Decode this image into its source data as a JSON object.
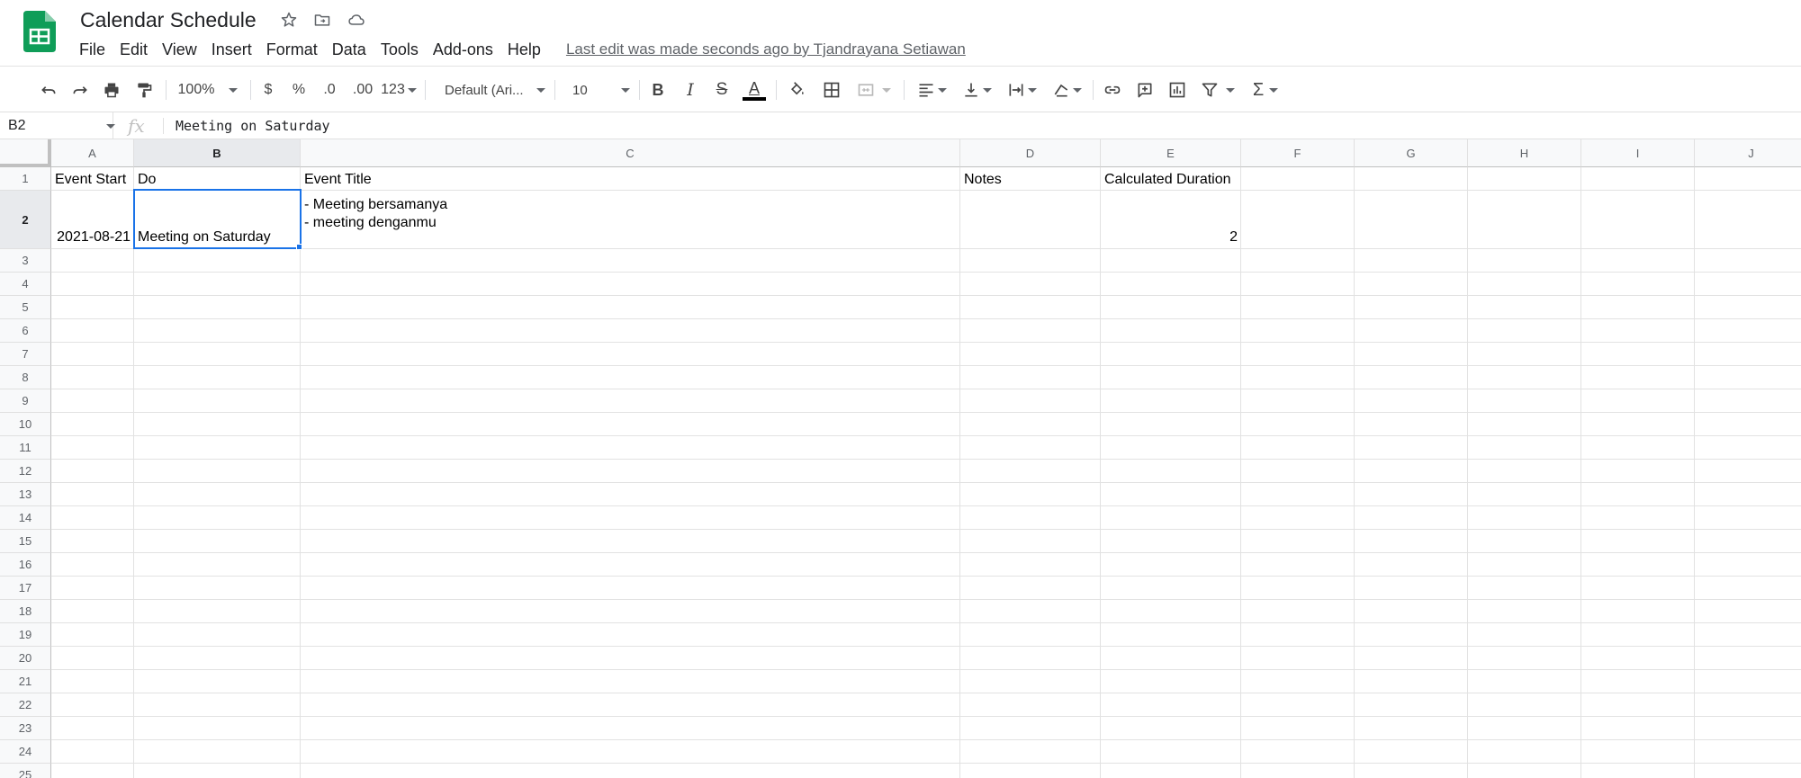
{
  "doc": {
    "title": "Calendar Schedule",
    "last_edit": "Last edit was made seconds ago by Tjandrayana Setiawan",
    "brand_color": "#0f9d58"
  },
  "menu": [
    "File",
    "Edit",
    "View",
    "Insert",
    "Format",
    "Data",
    "Tools",
    "Add-ons",
    "Help"
  ],
  "toolbar": {
    "zoom": "100%",
    "currency": "$",
    "percent": "%",
    "decrease_decimal": ".0",
    "increase_decimal": ".00",
    "more_formats": "123",
    "font": "Default (Ari...",
    "font_size": "10",
    "icons": [
      "undo-icon",
      "redo-icon",
      "print-icon",
      "paint-format-icon",
      "bold-icon",
      "italic-icon",
      "strikethrough-icon",
      "text-color-icon",
      "fill-color-icon",
      "borders-icon",
      "merge-cells-icon",
      "horizontal-align-icon",
      "vertical-align-icon",
      "text-wrapping-icon",
      "text-rotation-icon",
      "insert-link-icon",
      "insert-comment-icon",
      "insert-chart-icon",
      "filter-icon",
      "functions-icon"
    ]
  },
  "formula_bar": {
    "name_box": "B2",
    "fx": "fx",
    "content": "Meeting on Saturday"
  },
  "sheet": {
    "columns": [
      "A",
      "B",
      "C",
      "D",
      "E",
      "F",
      "G",
      "H",
      "I",
      "J"
    ],
    "rows": [
      "1",
      "2",
      "3",
      "4",
      "5",
      "6",
      "7",
      "8",
      "9",
      "10",
      "11",
      "12",
      "13",
      "14",
      "15",
      "16",
      "17",
      "18",
      "19",
      "20",
      "21",
      "22",
      "23",
      "24",
      "25"
    ],
    "selected_cell": "B2",
    "cells": {
      "A1": "Event Start",
      "B1": "Do",
      "C1": "Event Title",
      "D1": "Notes",
      "E1": "Calculated Duration",
      "A2": "2021-08-21",
      "B2": "Meeting on Saturday",
      "C2_line1": "- Meeting bersamanya",
      "C2_line2": "- meeting denganmu",
      "E2": "2"
    }
  }
}
